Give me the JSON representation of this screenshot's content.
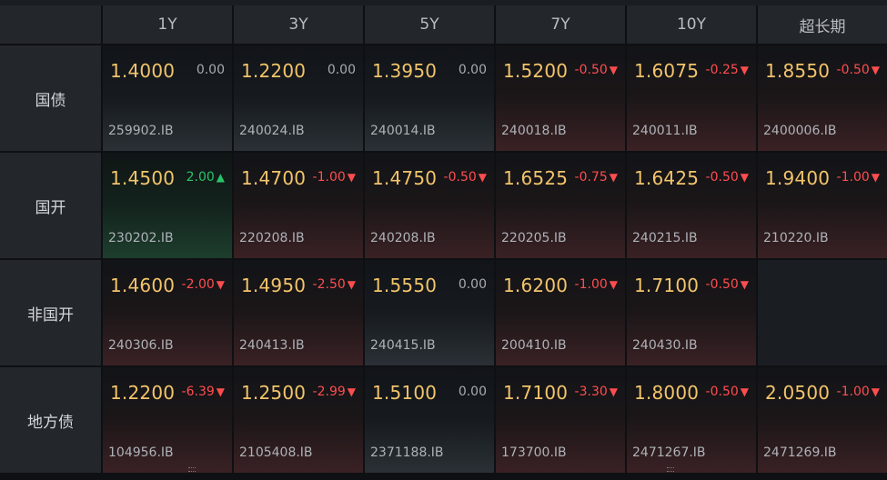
{
  "columns": [
    "1Y",
    "3Y",
    "5Y",
    "7Y",
    "10Y",
    "超长期"
  ],
  "rows": [
    {
      "label": "国债",
      "cells": [
        {
          "yield": "1.4000",
          "change": "0.00",
          "dir": "zero",
          "code": "259902.IB"
        },
        {
          "yield": "1.2200",
          "change": "0.00",
          "dir": "zero",
          "code": "240024.IB"
        },
        {
          "yield": "1.3950",
          "change": "0.00",
          "dir": "zero",
          "code": "240014.IB"
        },
        {
          "yield": "1.5200",
          "change": "-0.50",
          "dir": "down",
          "code": "240018.IB"
        },
        {
          "yield": "1.6075",
          "change": "-0.25",
          "dir": "down",
          "code": "240011.IB"
        },
        {
          "yield": "1.8550",
          "change": "-0.50",
          "dir": "down",
          "code": "2400006.IB"
        }
      ]
    },
    {
      "label": "国开",
      "cells": [
        {
          "yield": "1.4500",
          "change": "2.00",
          "dir": "up",
          "code": "230202.IB"
        },
        {
          "yield": "1.4700",
          "change": "-1.00",
          "dir": "down",
          "code": "220208.IB"
        },
        {
          "yield": "1.4750",
          "change": "-0.50",
          "dir": "down",
          "code": "240208.IB"
        },
        {
          "yield": "1.6525",
          "change": "-0.75",
          "dir": "down",
          "code": "220205.IB"
        },
        {
          "yield": "1.6425",
          "change": "-0.50",
          "dir": "down",
          "code": "240215.IB"
        },
        {
          "yield": "1.9400",
          "change": "-1.00",
          "dir": "down",
          "code": "210220.IB"
        }
      ]
    },
    {
      "label": "非国开",
      "cells": [
        {
          "yield": "1.4600",
          "change": "-2.00",
          "dir": "down",
          "code": "240306.IB"
        },
        {
          "yield": "1.4950",
          "change": "-2.50",
          "dir": "down",
          "code": "240413.IB"
        },
        {
          "yield": "1.5550",
          "change": "0.00",
          "dir": "zero",
          "code": "240415.IB"
        },
        {
          "yield": "1.6200",
          "change": "-1.00",
          "dir": "down",
          "code": "200410.IB"
        },
        {
          "yield": "1.7100",
          "change": "-0.50",
          "dir": "down",
          "code": "240430.IB"
        },
        null
      ]
    },
    {
      "label": "地方债",
      "cells": [
        {
          "yield": "1.2200",
          "change": "-6.39",
          "dir": "down",
          "code": "104956.IB"
        },
        {
          "yield": "1.2500",
          "change": "-2.99",
          "dir": "down",
          "code": "2105408.IB"
        },
        {
          "yield": "1.5100",
          "change": "0.00",
          "dir": "zero",
          "code": "2371188.IB"
        },
        {
          "yield": "1.7100",
          "change": "-3.30",
          "dir": "down",
          "code": "173700.IB"
        },
        {
          "yield": "1.8000",
          "change": "-0.50",
          "dir": "down",
          "code": "2471267.IB"
        },
        {
          "yield": "2.0500",
          "change": "-1.00",
          "dir": "down",
          "code": "2471269.IB"
        }
      ]
    }
  ],
  "icons": {
    "up": "triangle-up-icon",
    "down": "triangle-down-icon"
  },
  "colors": {
    "yield": "#f2c46b",
    "down": "#ff4d4f",
    "up": "#27c46a",
    "zero": "#a8abb0"
  }
}
